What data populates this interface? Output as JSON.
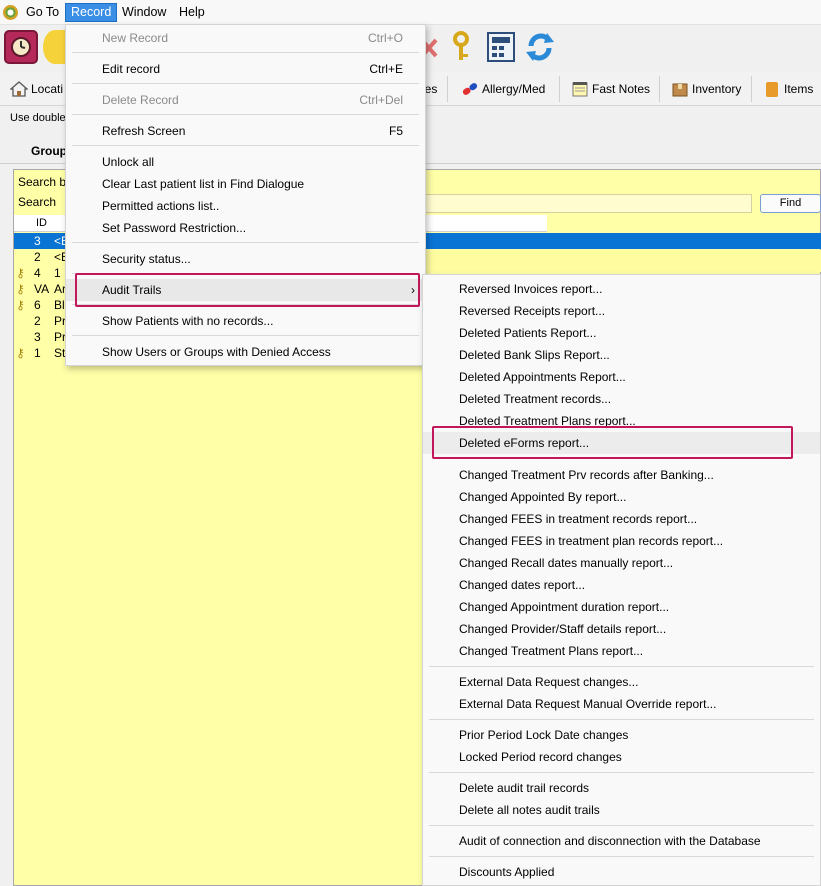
{
  "menubar": {
    "items": [
      {
        "label": "Go To"
      },
      {
        "label": "Record"
      },
      {
        "label": "Window"
      },
      {
        "label": "Help"
      }
    ]
  },
  "tabs": [
    {
      "label": "Locati"
    },
    {
      "label": "les"
    },
    {
      "label": "Allergy/Med"
    },
    {
      "label": "Fast Notes"
    },
    {
      "label": "Inventory"
    },
    {
      "label": "Items"
    }
  ],
  "hint_text": "Use double",
  "group_label": "Group",
  "search": {
    "by_label": "Search b",
    "label": "Search",
    "find_label": "Find"
  },
  "list": {
    "col_id": "ID",
    "rows": [
      {
        "id": "3",
        "name": "<E",
        "key": false,
        "selected": true
      },
      {
        "id": "2",
        "name": "<E",
        "key": false
      },
      {
        "id": "4",
        "name": "1",
        "key": true
      },
      {
        "id": "VA",
        "name": "Ar",
        "key": true
      },
      {
        "id": "6",
        "name": "Bl",
        "key": true
      },
      {
        "id": "2",
        "name": "Pr",
        "key": false
      },
      {
        "id": "3",
        "name": "Pr",
        "key": false
      },
      {
        "id": "1",
        "name": "St",
        "key": true
      }
    ]
  },
  "record_menu": {
    "items": [
      {
        "label": "New Record",
        "shortcut": "Ctrl+O",
        "disabled": true
      },
      {
        "label": "Edit record",
        "shortcut": "Ctrl+E"
      },
      {
        "label": "Delete Record",
        "shortcut": "Ctrl+Del",
        "disabled": true
      },
      {
        "label": "Refresh Screen",
        "shortcut": "F5"
      },
      {
        "label": "Unlock all"
      },
      {
        "label": "Clear Last patient list in Find Dialogue"
      },
      {
        "label": "Permitted actions list.."
      },
      {
        "label": "Set Password Restriction..."
      },
      {
        "label": "Security status..."
      },
      {
        "label": "Audit Trails",
        "submenu": true
      },
      {
        "label": "Show Patients with no records..."
      },
      {
        "label": "Show Users or Groups with Denied Access"
      }
    ]
  },
  "audit_submenu": {
    "items": [
      {
        "label": "Reversed Invoices report..."
      },
      {
        "label": "Reversed Receipts report..."
      },
      {
        "label": "Deleted Patients Report..."
      },
      {
        "label": "Deleted Bank Slips Report..."
      },
      {
        "label": "Deleted Appointments Report..."
      },
      {
        "label": "Deleted Treatment records..."
      },
      {
        "label": "Deleted Treatment Plans report..."
      },
      {
        "label": "Deleted eForms report..."
      },
      {
        "label": "Changed Treatment Prv records after Banking..."
      },
      {
        "label": "Changed Appointed By report..."
      },
      {
        "label": "Changed FEES in treatment records report..."
      },
      {
        "label": "Changed FEES in treatment plan records report..."
      },
      {
        "label": "Changed Recall dates manually report..."
      },
      {
        "label": "Changed dates report..."
      },
      {
        "label": "Changed Appointment duration report..."
      },
      {
        "label": "Changed Provider/Staff details report..."
      },
      {
        "label": "Changed Treatment Plans report..."
      },
      {
        "label": "External Data Request changes..."
      },
      {
        "label": "External Data Request Manual Override report..."
      },
      {
        "label": "Prior Period Lock Date changes"
      },
      {
        "label": "Locked Period record changes"
      },
      {
        "label": "Delete audit trail records"
      },
      {
        "label": "Delete all notes audit trails"
      },
      {
        "label": "Audit of connection and disconnection with the Database"
      },
      {
        "label": "Discounts Applied"
      }
    ]
  },
  "colors": {
    "accent": "#3a8ee6",
    "highlight_box": "#c2185b",
    "panel_yellow": "#ffffa8",
    "selection_blue": "#0a74d4"
  }
}
